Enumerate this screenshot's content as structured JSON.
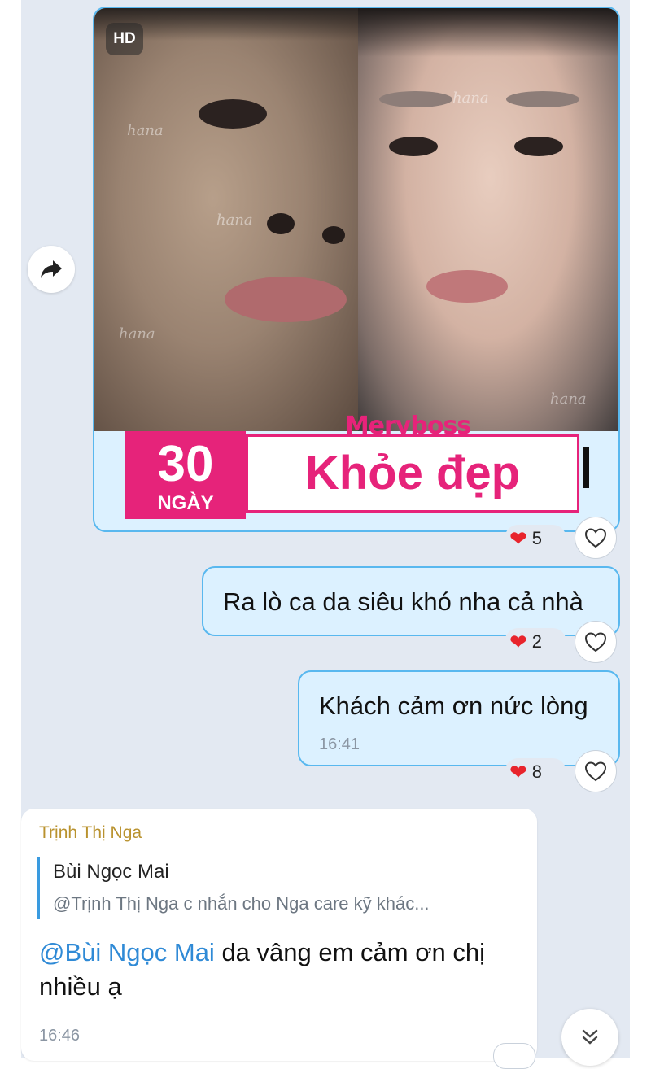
{
  "image_message": {
    "hd_badge": "HD",
    "watermark": "hana",
    "brand": "Meryboss",
    "banner_days_number": "30",
    "banner_days_unit": "NGÀY",
    "banner_headline": "Khỏe đẹp",
    "reaction_count": "5"
  },
  "messages": [
    {
      "text": "Ra lò ca da siêu khó nha cả nhà",
      "reaction_count": "2"
    },
    {
      "text": "Khách cảm ơn nức lòng",
      "time": "16:41",
      "reaction_count": "8"
    }
  ],
  "received": {
    "sender": "Trịnh Thị Nga",
    "quote_author": "Bùi Ngọc Mai",
    "quote_text": "@Trịnh Thị Nga c nhắn cho Nga care kỹ khác...",
    "mention": "@Bùi Ngọc Mai",
    "reply_text": " da vâng em cảm ơn chị nhiều ạ",
    "time": "16:46"
  },
  "icons": {
    "forward": "forward-arrow-icon",
    "like": "heart-outline-icon",
    "reaction": "red-heart-icon",
    "scroll": "double-chevron-down-icon"
  },
  "colors": {
    "chat_background": "#e3e9f2",
    "sent_bubble": "#dcf1ff",
    "sent_border": "#59b8ef",
    "brand_pink": "#e6237a",
    "sender_name": "#b9922e",
    "mention": "#2f8ad6"
  }
}
